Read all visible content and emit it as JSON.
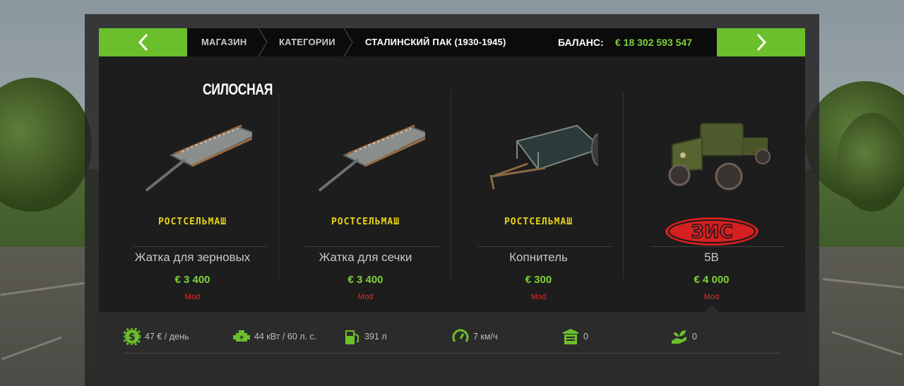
{
  "colors": {
    "accent": "#6cbf2c",
    "price": "#7ed13a",
    "mod": "#e32b2b",
    "brand_rost": "#e8d315",
    "brand_zis": "#d42020"
  },
  "nav": {
    "prev_icon": "chevron-left-icon",
    "next_icon": "chevron-right-icon",
    "breadcrumbs": [
      "МАГАЗИН",
      "КАТЕГОРИИ",
      "СТАЛИНСКИЙ ПАК (1930-1945)"
    ],
    "balance_label": "БАЛАНС:",
    "balance_value": "€ 18 302 593 547"
  },
  "category_title": "СИЛОСНАЯ",
  "items": [
    {
      "name": "Жатка для зерновых",
      "price": "€ 3 400",
      "tag": "Mod",
      "brand": "РОСТСЕЛЬМАШ",
      "icon": "header-attachment-icon"
    },
    {
      "name": "Жатка для сечки",
      "price": "€ 3 400",
      "tag": "Mod",
      "brand": "РОСТСЕЛЬМАШ",
      "icon": "header-attachment-icon"
    },
    {
      "name": "Копнитель",
      "price": "€ 300",
      "tag": "Mod",
      "brand": "РОСТСЕЛЬМАШ",
      "icon": "trailer-icon"
    },
    {
      "name": "5В",
      "price": "€ 4 000",
      "tag": "Mod",
      "brand": "ЗИС",
      "icon": "truck-icon"
    }
  ],
  "stats": [
    {
      "icon": "money-gear-icon",
      "value": "47 € / день"
    },
    {
      "icon": "engine-icon",
      "value": "44 кВт / 60 л. с."
    },
    {
      "icon": "fuel-pump-icon",
      "value": "391 л"
    },
    {
      "icon": "speedometer-icon",
      "value": "7 км/ч"
    },
    {
      "icon": "storage-icon",
      "value": "0"
    },
    {
      "icon": "hand-plant-icon",
      "value": "0"
    }
  ]
}
